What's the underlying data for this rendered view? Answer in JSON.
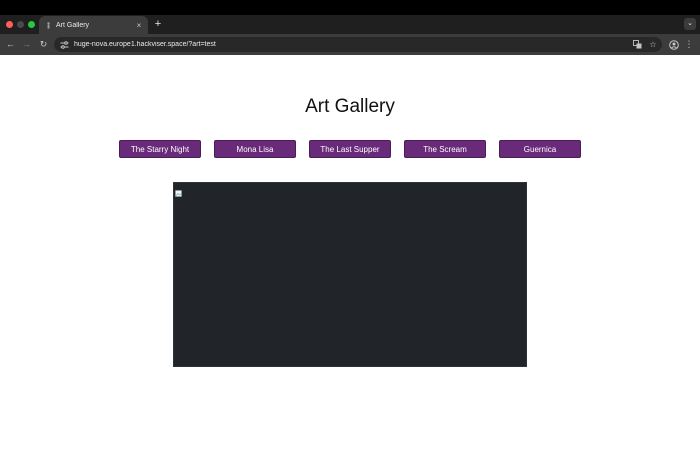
{
  "browser": {
    "tab": {
      "title": "Art Gallery",
      "favicon": "figure-icon",
      "close_glyph": "×"
    },
    "new_tab_glyph": "+",
    "tab_search_glyph": "⌄",
    "nav": {
      "back_glyph": "←",
      "forward_glyph": "→",
      "reload_glyph": "↻"
    },
    "address_bar": {
      "url": "huge-nova.europe1.hackviser.space/?art=test",
      "translate_icon": "translate-icon",
      "bookmark_glyph": "☆"
    },
    "menu_glyph": "⋮"
  },
  "page": {
    "title": "Art Gallery",
    "buttons": [
      {
        "label": "The Starry Night"
      },
      {
        "label": "Mona Lisa"
      },
      {
        "label": "The Last Supper"
      },
      {
        "label": "The Scream"
      },
      {
        "label": "Guernica"
      }
    ],
    "artwork": {
      "src": "",
      "state": "broken-image",
      "background": "#212529"
    }
  },
  "colors": {
    "button_bg": "#6a2a7a",
    "button_text": "#ffffff",
    "chrome_dark": "#1f1f1f",
    "toolbar": "#3c3c3c"
  }
}
